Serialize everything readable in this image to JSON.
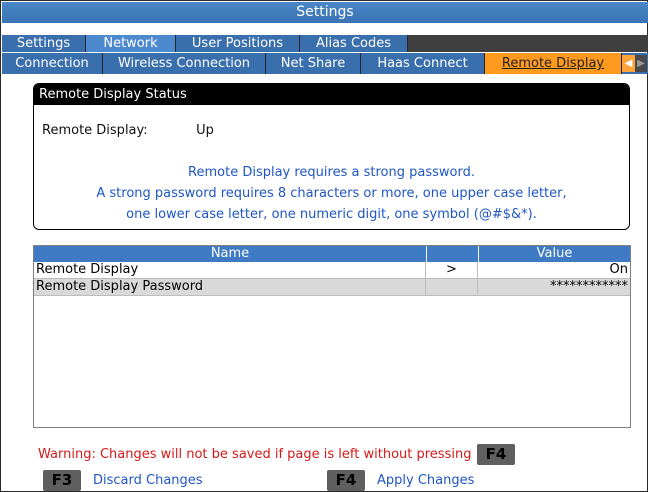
{
  "window": {
    "title": "Settings"
  },
  "tabs_primary": [
    {
      "label": "Settings",
      "active": false
    },
    {
      "label": "Network",
      "active": true
    },
    {
      "label": "User Positions",
      "active": false
    },
    {
      "label": "Alias Codes",
      "active": false
    }
  ],
  "tabs_secondary": [
    {
      "label": "Connection",
      "active": false
    },
    {
      "label": "Wireless Connection",
      "active": false
    },
    {
      "label": "Net Share",
      "active": false
    },
    {
      "label": "Haas Connect",
      "active": false
    },
    {
      "label": "Remote Display",
      "active": true
    }
  ],
  "status_panel": {
    "heading": "Remote Display Status",
    "status_label": "Remote Display:",
    "status_value": "Up",
    "info_lines": [
      "Remote Display requires a strong password.",
      "A strong password requires 8 characters or more, one upper case letter,",
      "one lower case letter, one numeric digit, one symbol (@#$&*)."
    ]
  },
  "settings_table": {
    "columns": {
      "name": "Name",
      "value": "Value"
    },
    "rows": [
      {
        "name": "Remote Display",
        "indicator": ">",
        "value": "On"
      },
      {
        "name": "Remote Display Password",
        "indicator": "",
        "value": "************"
      }
    ]
  },
  "footer": {
    "warning": "Warning: Changes will not be saved if page is left without pressing",
    "warning_key": "F4",
    "discard_key": "F3",
    "discard_label": "Discard Changes",
    "apply_key": "F4",
    "apply_label": "Apply Changes"
  },
  "colors": {
    "title_bar": "#3f7ac4",
    "active_tab": "#ff9a1f",
    "info_text": "#1f56c4",
    "warning_text": "#d41a1a"
  }
}
